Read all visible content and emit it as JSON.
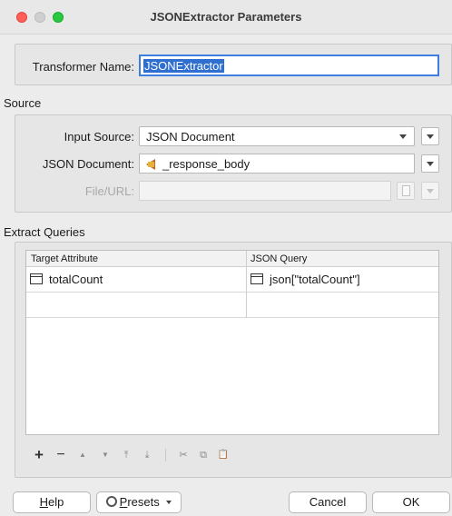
{
  "window": {
    "title": "JSONExtractor Parameters"
  },
  "transformer": {
    "label": "Transformer Name:",
    "value": "JSONExtractor"
  },
  "source": {
    "title": "Source",
    "input_source": {
      "label": "Input Source:",
      "value": "JSON Document"
    },
    "json_document": {
      "label": "JSON Document:",
      "value": "_response_body"
    },
    "file_url": {
      "label": "File/URL:",
      "value": ""
    }
  },
  "queries": {
    "title": "Extract Queries",
    "columns": [
      "Target Attribute",
      "JSON Query"
    ],
    "rows": [
      {
        "attribute": "totalCount",
        "query": "json[\"totalCount\"]"
      },
      {
        "attribute": "",
        "query": ""
      }
    ]
  },
  "toolbar": {
    "add": "+",
    "remove": "−",
    "up": "▲",
    "down": "▼",
    "top": "⤒",
    "bottom": "⤓",
    "cut": "✂",
    "copy": "⧉",
    "paste": "📋"
  },
  "buttons": {
    "help_u": "H",
    "help_rest": "elp",
    "presets_u": "P",
    "presets_rest": "resets",
    "cancel": "Cancel",
    "ok": "OK"
  },
  "colors": {
    "accent": "#2f6fd0",
    "attr_icon": "#c0662a"
  }
}
